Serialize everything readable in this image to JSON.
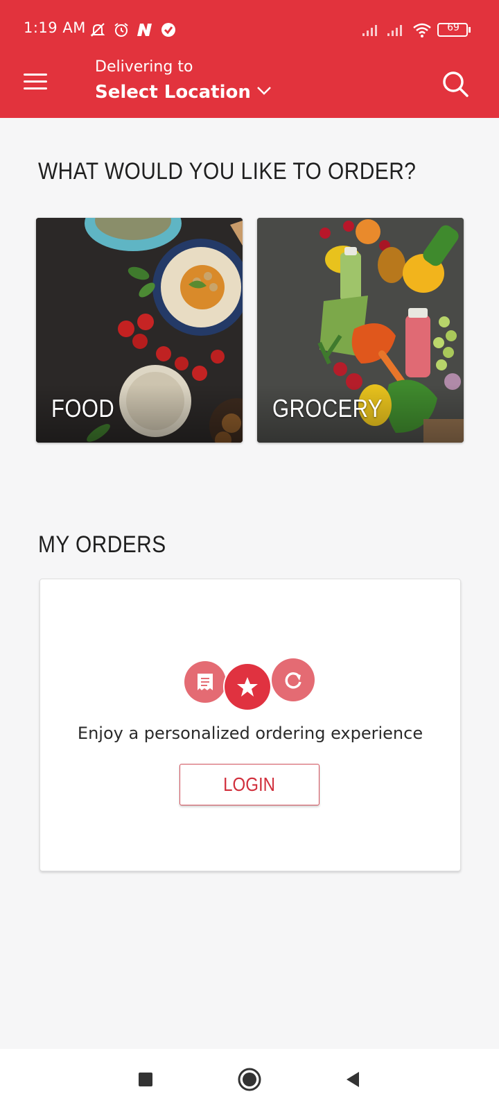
{
  "status_bar": {
    "time": "1:19 AM",
    "battery": "69",
    "icons": [
      "notifications-off-icon",
      "alarm-icon",
      "n-app-icon",
      "check-circle-icon",
      "signal-icon",
      "signal-icon",
      "wifi-icon",
      "battery-icon"
    ]
  },
  "header": {
    "delivering_label": "Delivering to",
    "location": "Select Location",
    "menu_icon": "hamburger-menu-icon",
    "search_icon": "search-icon",
    "background_color": "#e2333d"
  },
  "main": {
    "order_heading": "WHAT WOULD YOU LIKE TO ORDER?",
    "categories": [
      {
        "label": "FOOD"
      },
      {
        "label": "GROCERY"
      }
    ],
    "orders_heading": "MY ORDERS",
    "orders_card": {
      "icons": [
        "receipt-icon",
        "star-icon",
        "reorder-icon"
      ],
      "message": "Enjoy a personalized ordering experience",
      "login_label": "LOGIN"
    }
  },
  "system_nav": {
    "icons": [
      "recents-square-icon",
      "home-circle-icon",
      "back-triangle-icon"
    ]
  },
  "colors": {
    "accent": "#e2333d",
    "background": "#f6f6f7"
  }
}
